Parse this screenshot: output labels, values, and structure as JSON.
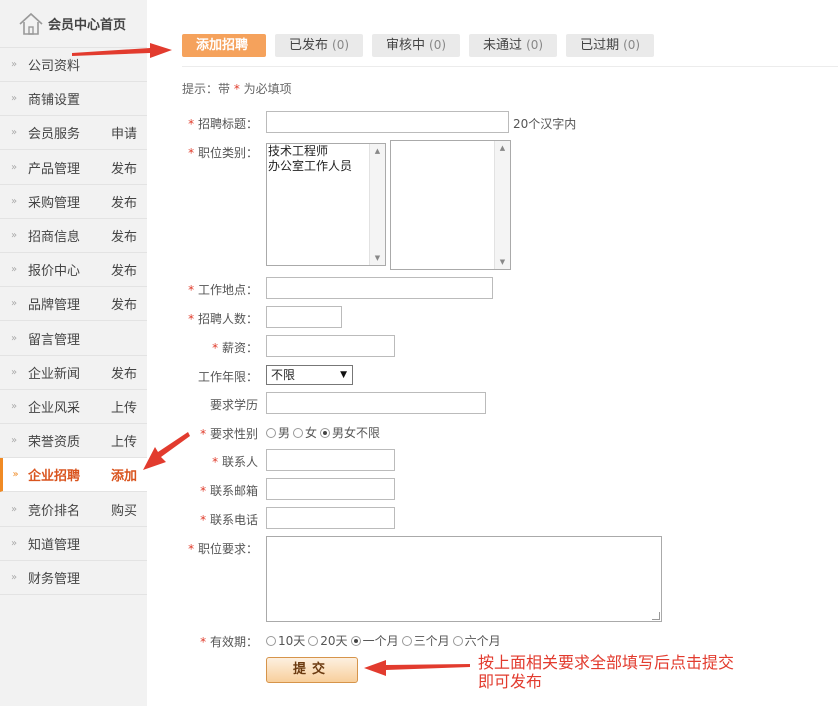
{
  "sidebar": {
    "home_label": "会员中心首页",
    "items": [
      {
        "label": "公司资料",
        "action": ""
      },
      {
        "label": "商铺设置",
        "action": ""
      },
      {
        "label": "会员服务",
        "action": "申请"
      },
      {
        "label": "产品管理",
        "action": "发布"
      },
      {
        "label": "采购管理",
        "action": "发布"
      },
      {
        "label": "招商信息",
        "action": "发布"
      },
      {
        "label": "报价中心",
        "action": "发布"
      },
      {
        "label": "品牌管理",
        "action": "发布"
      },
      {
        "label": "留言管理",
        "action": ""
      },
      {
        "label": "企业新闻",
        "action": "发布"
      },
      {
        "label": "企业风采",
        "action": "上传"
      },
      {
        "label": "荣誉资质",
        "action": "上传"
      },
      {
        "label": "企业招聘",
        "action": "添加",
        "active": true
      },
      {
        "label": "竞价排名",
        "action": "购买"
      },
      {
        "label": "知道管理",
        "action": ""
      },
      {
        "label": "财务管理",
        "action": ""
      }
    ]
  },
  "tabs": [
    {
      "label": "添加招聘",
      "count": "",
      "active": true
    },
    {
      "label": "已发布",
      "count": "(0)"
    },
    {
      "label": "审核中",
      "count": "(0)"
    },
    {
      "label": "未通过",
      "count": "(0)"
    },
    {
      "label": "已过期",
      "count": "(0)"
    }
  ],
  "hint": {
    "prefix": "提示：带",
    "star": "*",
    "suffix": "为必填项"
  },
  "form": {
    "title": {
      "label": "招聘标题：",
      "value": "",
      "note": "20个汉字内"
    },
    "category": {
      "label": "职位类别：",
      "options": [
        "技术工程师",
        "办公室工作人员"
      ]
    },
    "location": {
      "label": "工作地点：",
      "value": ""
    },
    "headcount": {
      "label": "招聘人数：",
      "value": ""
    },
    "salary": {
      "label": "薪资：",
      "value": ""
    },
    "experience": {
      "label": "工作年限：",
      "selected": "不限"
    },
    "education": {
      "label": "要求学历",
      "value": ""
    },
    "gender": {
      "label": "要求性别",
      "options": [
        "男",
        "女",
        "男女不限"
      ],
      "selected_index": 2
    },
    "contact": {
      "label": "联系人",
      "value": ""
    },
    "email": {
      "label": "联系邮箱",
      "value": ""
    },
    "phone": {
      "label": "联系电话",
      "value": ""
    },
    "requirements": {
      "label": "职位要求：",
      "value": ""
    },
    "validity": {
      "label": "有效期：",
      "options": [
        "10天",
        "20天",
        "一个月",
        "三个月",
        "六个月"
      ],
      "selected_index": 2
    },
    "submit_label": "提交"
  },
  "annotation": {
    "line1": "按上面相关要求全部填写后点击提交",
    "line2": "即可发布"
  },
  "colors": {
    "accent": "#f5a25c",
    "annotation": "#e23b2e",
    "active_text": "#d9541e"
  }
}
